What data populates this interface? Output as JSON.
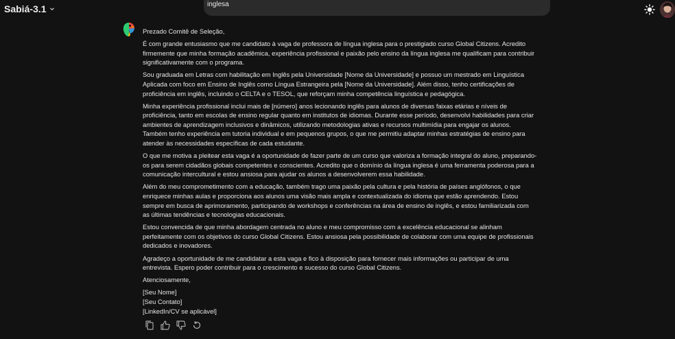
{
  "header": {
    "model_name": "Sabiá-3.1",
    "prompt_excerpt": "inglesa"
  },
  "message": {
    "salutation": "Prezado Comitê de Seleção,",
    "paragraphs": [
      "É com grande entusiasmo que me candidato à vaga de professora de língua inglesa para o prestigiado curso Global Citizens. Acredito firmemente que minha formação acadêmica, experiência profissional e paixão pelo ensino da língua inglesa me qualificam para contribuir significativamente com o programa.",
      "Sou graduada em Letras com habilitação em Inglês pela Universidade [Nome da Universidade] e possuo um mestrado em Linguística Aplicada com foco em Ensino de Inglês como Língua Estrangeira pela [Nome da Universidade]. Além disso, tenho certificações de proficiência em inglês, incluindo o CELTA e o TESOL, que reforçam minha competência linguística e pedagógica.",
      "Minha experiência profissional inclui mais de [número] anos lecionando inglês para alunos de diversas faixas etárias e níveis de proficiência, tanto em escolas de ensino regular quanto em institutos de idiomas. Durante esse período, desenvolvi habilidades para criar ambientes de aprendizagem inclusivos e dinâmicos, utilizando metodologias ativas e recursos multimídia para engajar os alunos. Também tenho experiência em tutoria individual e em pequenos grupos, o que me permitiu adaptar minhas estratégias de ensino para atender às necessidades específicas de cada estudante.",
      "O que me motiva a pleitear esta vaga é a oportunidade de fazer parte de um curso que valoriza a formação integral do aluno, preparando-os para serem cidadãos globais competentes e conscientes. Acredito que o domínio da língua inglesa é uma ferramenta poderosa para a comunicação intercultural e estou ansiosa para ajudar os alunos a desenvolverem essa habilidade.",
      "Além do meu comprometimento com a educação, também trago uma paixão pela cultura e pela história de países anglófonos, o que enriquece minhas aulas e proporciona aos alunos uma visão mais ampla e contextualizada do idioma que estão aprendendo. Estou sempre em busca de aprimoramento, participando de workshops e conferências na área de ensino de inglês, e estou familiarizada com as últimas tendências e tecnologias educacionais.",
      "Estou convencida de que minha abordagem centrada no aluno e meu compromisso com a excelência educacional se alinham perfeitamente com os objetivos do curso Global Citizens. Estou ansiosa pela possibilidade de colaborar com uma equipe de profissionais dedicados e inovadores.",
      "Agradeço a oportunidade de me candidatar a esta vaga e fico à disposição para fornecer mais informações ou participar de uma entrevista. Espero poder contribuir para o crescimento e sucesso do curso Global Citizens."
    ],
    "closing": "Atenciosamente,",
    "signature": [
      "[Seu Nome]",
      "[Seu Contato]",
      "[LinkedIn/CV se aplicável]"
    ]
  },
  "actions": [
    "copy-icon",
    "thumbs-up-icon",
    "thumbs-down-icon",
    "regenerate-icon"
  ],
  "colors": {
    "background": "#121212",
    "text": "#e6e6e6",
    "pill": "#2b2b2b",
    "icon": "#a8a8a8"
  }
}
